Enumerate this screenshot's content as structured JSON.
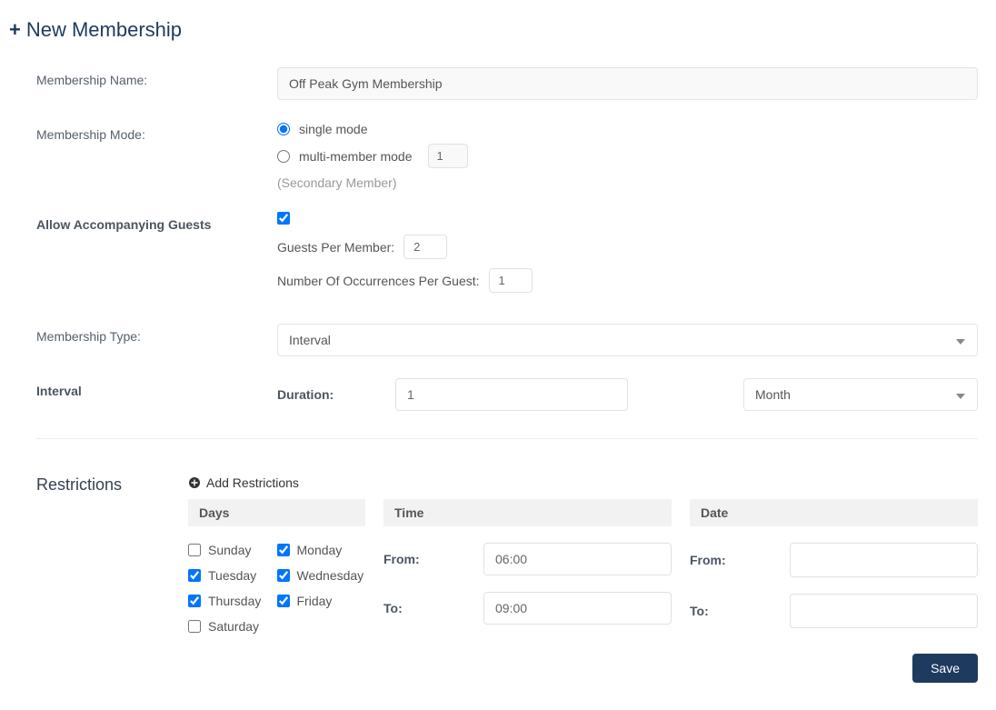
{
  "header": {
    "title": "New Membership"
  },
  "fields": {
    "name": {
      "label": "Membership Name:",
      "value": "Off Peak Gym Membership"
    },
    "mode": {
      "label": "Membership Mode:",
      "single": "single mode",
      "multi": "multi-member mode",
      "multiValue": "1",
      "secondary": "(Secondary Member)",
      "selected": "single"
    },
    "guests": {
      "label": "Allow Accompanying Guests",
      "checked": true,
      "perMemberLabel": "Guests Per Member:",
      "perMemberValue": "2",
      "perGuestLabel": "Number Of Occurrences Per Guest:",
      "perGuestValue": "1"
    },
    "type": {
      "label": "Membership Type:",
      "value": "Interval"
    },
    "interval": {
      "label": "Interval",
      "durationLabel": "Duration:",
      "durationValue": "1",
      "unit": "Month"
    }
  },
  "restrictions": {
    "title": "Restrictions",
    "addLabel": "Add Restrictions",
    "headers": {
      "days": "Days",
      "time": "Time",
      "date": "Date"
    },
    "days": [
      {
        "name": "Sunday",
        "checked": false
      },
      {
        "name": "Monday",
        "checked": true
      },
      {
        "name": "Tuesday",
        "checked": true
      },
      {
        "name": "Wednesday",
        "checked": true
      },
      {
        "name": "Thursday",
        "checked": true
      },
      {
        "name": "Friday",
        "checked": true
      },
      {
        "name": "Saturday",
        "checked": false
      }
    ],
    "time": {
      "fromLabel": "From:",
      "fromValue": "06:00",
      "toLabel": "To:",
      "toValue": "09:00"
    },
    "date": {
      "fromLabel": "From:",
      "fromValue": "",
      "toLabel": "To:",
      "toValue": ""
    }
  },
  "actions": {
    "save": "Save"
  }
}
